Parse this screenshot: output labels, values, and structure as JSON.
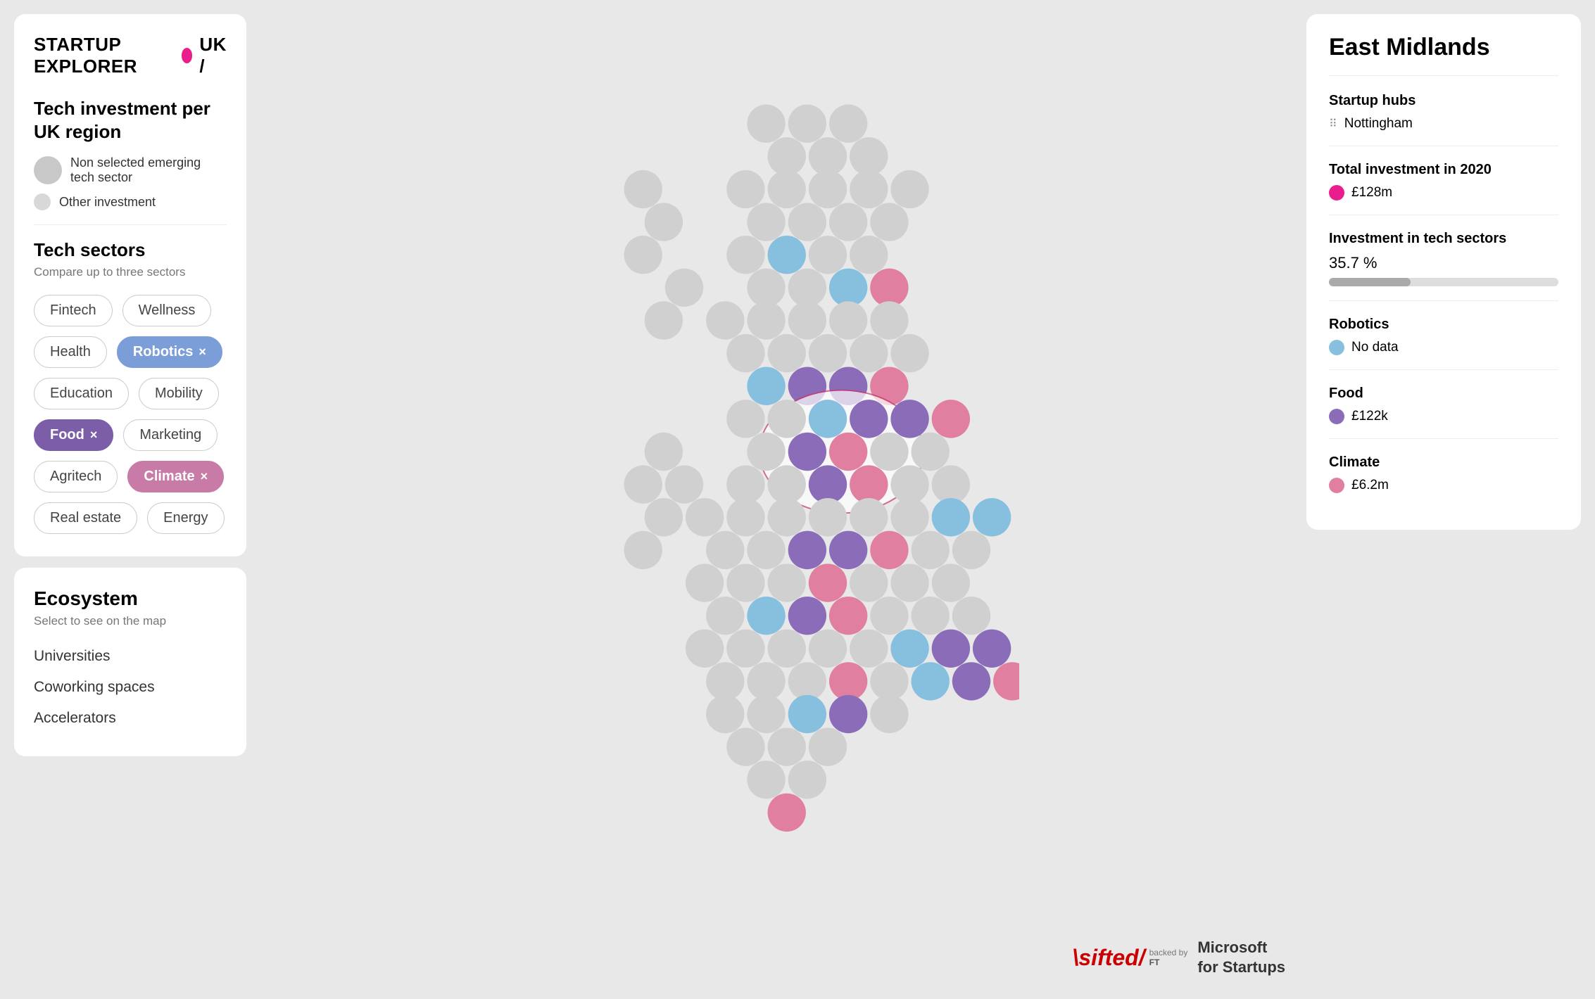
{
  "app": {
    "title": "STARTUP EXPLORER",
    "subtitle": "UK /"
  },
  "sidebar": {
    "investment_title": "Tech investment per UK region",
    "legend": [
      {
        "id": "non-selected",
        "label": "Non selected emerging tech sector",
        "size": "large"
      },
      {
        "id": "other",
        "label": "Other investment",
        "size": "small"
      }
    ],
    "tech_sectors_title": "Tech sectors",
    "tech_sectors_subtitle": "Compare up to three sectors",
    "sectors": [
      {
        "id": "fintech",
        "label": "Fintech",
        "active": false,
        "color": null
      },
      {
        "id": "wellness",
        "label": "Wellness",
        "active": false,
        "color": null
      },
      {
        "id": "health",
        "label": "Health",
        "active": false,
        "color": null
      },
      {
        "id": "robotics",
        "label": "Robotics",
        "active": true,
        "color": "blue"
      },
      {
        "id": "education",
        "label": "Education",
        "active": false,
        "color": null
      },
      {
        "id": "mobility",
        "label": "Mobility",
        "active": false,
        "color": null
      },
      {
        "id": "food",
        "label": "Food",
        "active": true,
        "color": "purple"
      },
      {
        "id": "marketing",
        "label": "Marketing",
        "active": false,
        "color": null
      },
      {
        "id": "agritech",
        "label": "Agritech",
        "active": false,
        "color": null
      },
      {
        "id": "climate",
        "label": "Climate",
        "active": true,
        "color": "pink"
      },
      {
        "id": "real-estate",
        "label": "Real estate",
        "active": false,
        "color": null
      },
      {
        "id": "energy",
        "label": "Energy",
        "active": false,
        "color": null
      }
    ]
  },
  "ecosystem": {
    "title": "Ecosystem",
    "subtitle": "Select to see on the map",
    "items": [
      "Universities",
      "Coworking spaces",
      "Accelerators"
    ]
  },
  "region_panel": {
    "title": "East Midlands",
    "hubs_label": "Startup hubs",
    "hubs": [
      "Nottingham"
    ],
    "total_investment_label": "Total investment in 2020",
    "total_investment": "£128m",
    "total_investment_color": "#e91e8c",
    "tech_sectors_label": "Investment in tech sectors",
    "tech_percentage": "35.7 %",
    "tech_bar_width": 35.7,
    "sectors_data": [
      {
        "name": "Robotics",
        "value": "No data",
        "color": "#87BFDF"
      },
      {
        "name": "Food",
        "value": "£122k",
        "color": "#8B6CB8"
      },
      {
        "name": "Climate",
        "value": "£6.2m",
        "color": "#E07FA0"
      }
    ]
  },
  "branding": {
    "sifted": "\\sifted/",
    "backed_by": "backed by",
    "ft": "FT",
    "microsoft": "Microsoft\nfor Startups"
  }
}
